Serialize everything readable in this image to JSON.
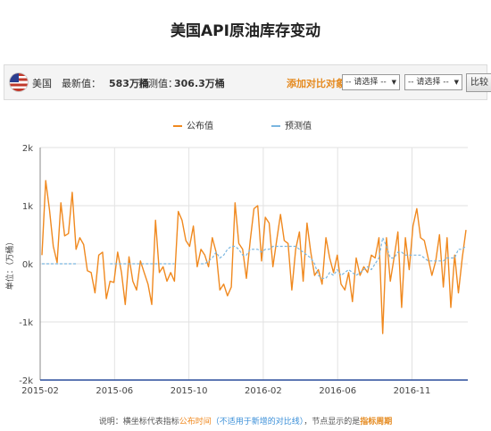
{
  "title": "美国API原油库存变动",
  "info": {
    "country": "美国",
    "latest_label": "最新值：",
    "latest_value": "583万桶",
    "forecast_label": "预测值：",
    "forecast_value": "306.3万桶",
    "compare_label": "添加对比对象：",
    "select1": "-- 请选择 --",
    "select2": "-- 请选择 --",
    "compare_button": "比较"
  },
  "note": {
    "prefix": "说明：横坐标代表指标",
    "t1": "公布时间",
    "t2": "（不适用于新增的对比线）",
    "t3": "，节点显示的是",
    "t4": "指标周期"
  },
  "colors": {
    "published": "#f0891f",
    "forecast": "#7ab6e0",
    "accent": "#e58a1f"
  },
  "chart_data": {
    "type": "line",
    "x_ticks": [
      "2015-02",
      "2015-06",
      "2015-10",
      "2016-02",
      "2016-06",
      "2016-11"
    ],
    "y_ticks": [
      "2k",
      "1k",
      "0k",
      "-1k",
      "-2k"
    ],
    "y_range": [
      -2000,
      2000
    ],
    "ylabel": "单位：（万桶）",
    "grid": true,
    "legend_position": "top",
    "series": [
      {
        "name": "公布值",
        "values": [
          150,
          1430,
          920,
          300,
          20,
          1050,
          480,
          520,
          1230,
          250,
          450,
          330,
          -120,
          -150,
          -500,
          150,
          200,
          -600,
          -300,
          -320,
          200,
          -150,
          -700,
          120,
          -300,
          -450,
          50,
          -150,
          -350,
          -700,
          750,
          -150,
          -50,
          -300,
          -150,
          -300,
          900,
          750,
          400,
          300,
          650,
          -50,
          250,
          150,
          -50,
          450,
          200,
          -450,
          -350,
          -550,
          -400,
          1050,
          350,
          250,
          -250,
          400,
          950,
          1000,
          50,
          800,
          700,
          -50,
          400,
          850,
          400,
          350,
          -450,
          250,
          550,
          -300,
          700,
          200,
          -200,
          -100,
          -350,
          450,
          100,
          -150,
          150,
          -350,
          -450,
          -150,
          -650,
          100,
          -200,
          -50,
          -150,
          150,
          100,
          450,
          -1200,
          450,
          -300,
          100,
          550,
          -750,
          450,
          -100,
          650,
          950,
          450,
          400,
          100,
          -200,
          50,
          500,
          -400,
          450,
          -750,
          150,
          -500,
          100,
          583
        ],
        "color": "#f0891f"
      },
      {
        "name": "预测值",
        "values": [
          0,
          0,
          0,
          0,
          0,
          0,
          0,
          0,
          0,
          0,
          null,
          null,
          null,
          null,
          null,
          null,
          null,
          null,
          0,
          0,
          0,
          0,
          0,
          0,
          0,
          0,
          0,
          0,
          0,
          0,
          0,
          0,
          0,
          0,
          0,
          0,
          null,
          null,
          null,
          null,
          null,
          null,
          0,
          0,
          50,
          100,
          200,
          100,
          150,
          250,
          300,
          300,
          250,
          150,
          150,
          250,
          250,
          250,
          200,
          250,
          250,
          300,
          300,
          300,
          300,
          300,
          300,
          300,
          250,
          200,
          150,
          100,
          0,
          -200,
          -250,
          -250,
          -150,
          -200,
          -100,
          -200,
          -150,
          -100,
          -150,
          -200,
          -150,
          -100,
          -50,
          -100,
          0,
          100,
          450,
          300,
          100,
          100,
          200,
          200,
          150,
          150,
          150,
          150,
          150,
          100,
          50,
          50,
          50,
          50,
          50,
          100,
          100,
          100,
          250,
          250,
          306.3
        ],
        "color": "#7ab6e0"
      }
    ]
  }
}
